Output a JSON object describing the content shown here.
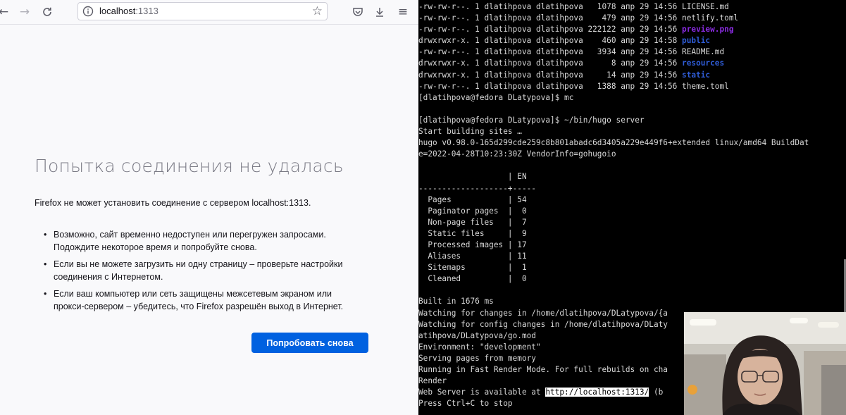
{
  "browser": {
    "nav": {
      "back_icon": "arrow-left-icon",
      "forward_icon": "arrow-right-icon",
      "reload_icon": "reload-icon"
    },
    "url": {
      "host": "localhost",
      "port": ":1313"
    },
    "toolbar_icons": [
      "pocket-icon",
      "download-icon",
      "menu-icon"
    ],
    "error": {
      "title": "Попытка соединения не удалась",
      "description": "Firefox не может установить соединение с сервером localhost:1313.",
      "items": [
        {
          "line1": "Возможно, сайт временно недоступен или перегружен запросами.",
          "line2": "Подождите некоторое время и попробуйте снова."
        },
        {
          "line1": "Если вы не можете загрузить ни одну страницу – проверьте настройки",
          "line2": "соединения с Интернетом."
        },
        {
          "line1": "Если ваш компьютер или сеть защищены межсетевым экраном или",
          "line2": "прокси-сервером – убедитесь, что Firefox разрешён выход в Интернет."
        }
      ],
      "retry_label": "Попробовать снова"
    },
    "colors": {
      "primary_button": "#0061e0"
    }
  },
  "terminal": {
    "files": [
      {
        "perm": "-rw-rw-r--.",
        "n": "1",
        "user": "dlatihpova",
        "group": "dlatihpova",
        "size": "1078",
        "date": "апр 29 14:56",
        "name": "LICENSE.md",
        "kind": "file"
      },
      {
        "perm": "-rw-rw-r--.",
        "n": "1",
        "user": "dlatihpova",
        "group": "dlatihpova",
        "size": "479",
        "date": "апр 29 14:56",
        "name": "netlify.toml",
        "kind": "file"
      },
      {
        "perm": "-rw-rw-r--.",
        "n": "1",
        "user": "dlatihpova",
        "group": "dlatihpova",
        "size": "222122",
        "date": "апр 29 14:56",
        "name": "preview.png",
        "kind": "image"
      },
      {
        "perm": "drwxrwxr-x.",
        "n": "1",
        "user": "dlatihpova",
        "group": "dlatihpova",
        "size": "460",
        "date": "апр 29 14:58",
        "name": "public",
        "kind": "dir"
      },
      {
        "perm": "-rw-rw-r--.",
        "n": "1",
        "user": "dlatihpova",
        "group": "dlatihpova",
        "size": "3934",
        "date": "апр 29 14:56",
        "name": "README.md",
        "kind": "file"
      },
      {
        "perm": "drwxrwxr-x.",
        "n": "1",
        "user": "dlatihpova",
        "group": "dlatihpova",
        "size": "8",
        "date": "апр 29 14:56",
        "name": "resources",
        "kind": "dir"
      },
      {
        "perm": "drwxrwxr-x.",
        "n": "1",
        "user": "dlatihpova",
        "group": "dlatihpova",
        "size": "14",
        "date": "апр 29 14:56",
        "name": "static",
        "kind": "dir"
      },
      {
        "perm": "-rw-rw-r--.",
        "n": "1",
        "user": "dlatihpova",
        "group": "dlatihpova",
        "size": "1388",
        "date": "апр 29 14:56",
        "name": "theme.toml",
        "kind": "file"
      }
    ],
    "prompt1": "[dlatihpova@fedora DLatypova]$ mc",
    "prompt2": "[dlatihpova@fedora DLatypova]$ ~/bin/hugo server",
    "start": "Start building sites …",
    "version1": "hugo v0.98.0-165d299cde259c8b801abadc6d3405a229e449f6+extended linux/amd64 BuildDat",
    "version2": "e=2022-04-28T10:23:30Z VendorInfo=gohugoio",
    "stats_header": "                   | EN",
    "stats_sep": "-------------------+-----",
    "stats": [
      {
        "label": "Pages",
        "value": "54"
      },
      {
        "label": "Paginator pages",
        "value": "0"
      },
      {
        "label": "Non-page files",
        "value": "7"
      },
      {
        "label": "Static files",
        "value": "9"
      },
      {
        "label": "Processed images",
        "value": "17"
      },
      {
        "label": "Aliases",
        "value": "11"
      },
      {
        "label": "Sitemaps",
        "value": "1"
      },
      {
        "label": "Cleaned",
        "value": "0"
      }
    ],
    "built": "Built in 1676 ms",
    "watching1": "Watching for changes in /home/dlatihpova/DLatypova/{a",
    "watching2": "Watching for config changes in /home/dlatihpova/DLaty",
    "watching3": "atihpova/DLatypova/go.mod",
    "environment": "Environment: \"development\"",
    "serving": "Serving pages from memory",
    "fast_render": "Running in Fast Render Mode. For full rebuilds on cha",
    "render": "Render",
    "web_server_prefix": "Web Server is available at ",
    "web_server_url": "http://localhost:1313/",
    "web_server_suffix": " (b",
    "ctrl_c": "Press Ctrl+C to stop",
    "colors": {
      "background": "#000000",
      "text": "#d8d8d8",
      "image_file": "#8a2be2",
      "directory": "#2f5cd6"
    }
  }
}
